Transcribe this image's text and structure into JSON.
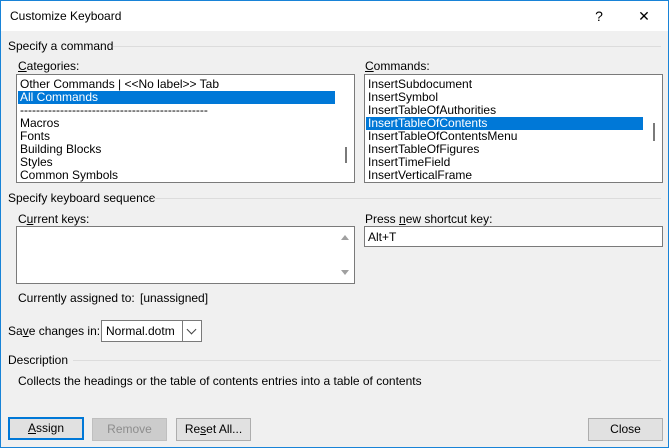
{
  "window": {
    "title": "Customize Keyboard",
    "help_glyph": "?",
    "close_glyph": "✕"
  },
  "specify_command": {
    "heading": "Specify a command",
    "categories_label_u": "C",
    "categories_label_rest": "ategories:",
    "categories": [
      "Other Commands | <<No label>> Tab",
      "All Commands",
      "-----------------------------------------------",
      "Macros",
      "Fonts",
      "Building Blocks",
      "Styles",
      "Common Symbols"
    ],
    "selected_category": "All Commands",
    "commands_label_u": "C",
    "commands_label_rest": "ommands:",
    "commands": [
      "InsertSubdocument",
      "InsertSymbol",
      "InsertTableOfAuthorities",
      "InsertTableOfContents",
      "InsertTableOfContentsMenu",
      "InsertTableOfFigures",
      "InsertTimeField",
      "InsertVerticalFrame"
    ],
    "selected_command": "InsertTableOfContents"
  },
  "keyboard_sequence": {
    "heading": "Specify keyboard sequence",
    "current_keys_label_pre": "C",
    "current_keys_label_u": "u",
    "current_keys_label_rest": "rrent keys:",
    "press_new_label_pre": "Press ",
    "press_new_label_u": "n",
    "press_new_label_rest": "ew shortcut key:",
    "new_shortcut_value": "Alt+T",
    "currently_assigned_label": "Currently assigned to:",
    "currently_assigned_value": "[unassigned]"
  },
  "save_changes": {
    "label_pre": "Sa",
    "label_u": "v",
    "label_rest": "e changes in:",
    "value": "Normal.dotm"
  },
  "description": {
    "heading": "Description",
    "text": "Collects the headings or the table of contents entries into a table of contents"
  },
  "buttons": {
    "assign_u": "A",
    "assign_rest": "ssign",
    "remove": "Remove",
    "reset_pre": "Re",
    "reset_u": "s",
    "reset_rest": "et All...",
    "close": "Close"
  },
  "colors": {
    "selection": "#0078d7",
    "window_border": "#1883d7",
    "dialog_bg": "#f0f0f0"
  }
}
